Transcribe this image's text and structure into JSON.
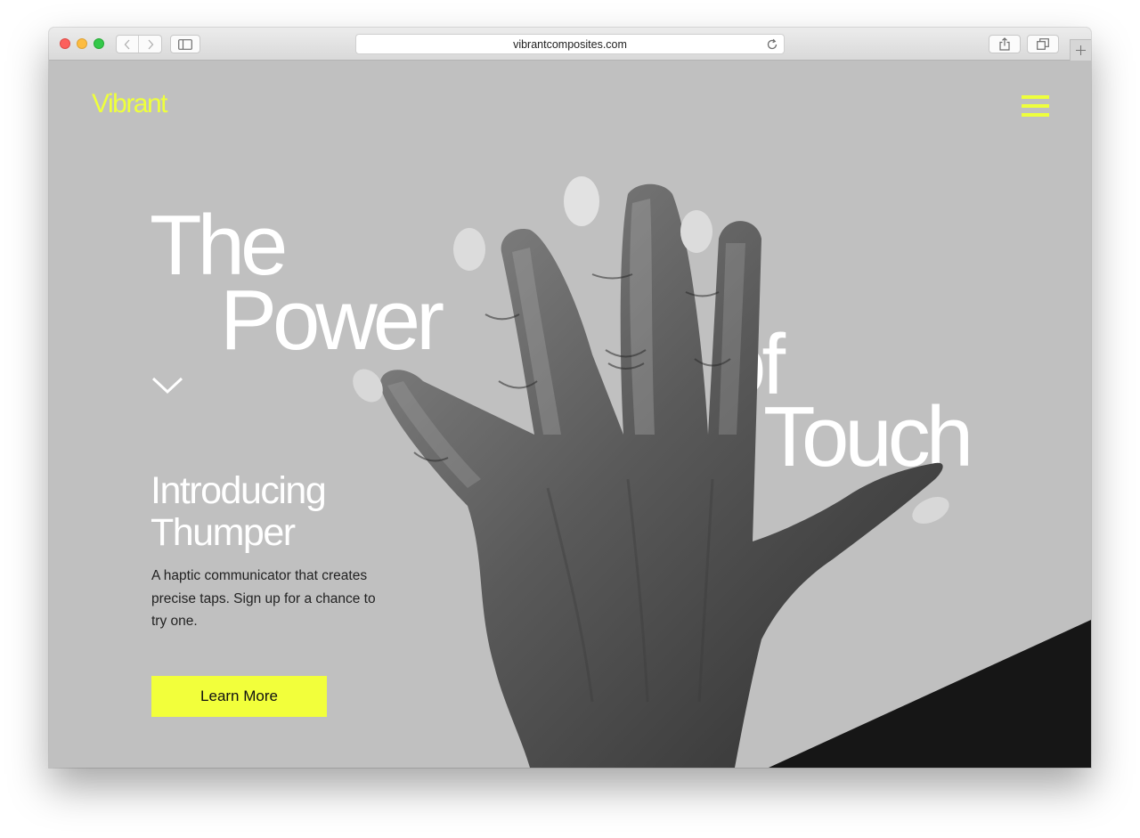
{
  "browser": {
    "url": "vibrantcomposites.com"
  },
  "site": {
    "logo": "Vibrant",
    "hero": {
      "line1": "The",
      "line2": "Power",
      "line3": "of",
      "line4": "Touch"
    },
    "intro_title": "Introducing Thumper",
    "description": "A haptic communicator that creates precise taps. Sign up for a chance to try one.",
    "cta_label": "Learn More"
  },
  "colors": {
    "accent": "#eeff3c",
    "background": "#c0c0c0",
    "dark": "#161616"
  },
  "icons": [
    "back-icon",
    "forward-icon",
    "sidebar-icon",
    "reload-icon",
    "share-icon",
    "tabs-icon",
    "plus-icon",
    "menu-icon",
    "chevron-down-icon"
  ]
}
